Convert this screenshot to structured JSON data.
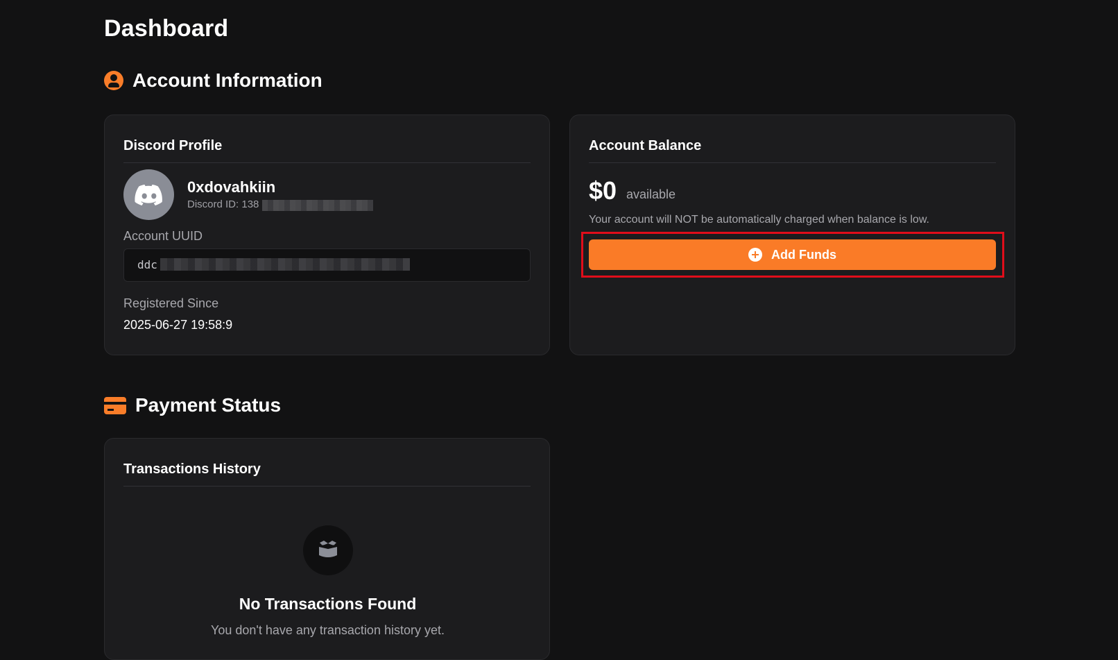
{
  "page": {
    "title": "Dashboard"
  },
  "account_section": {
    "title": "Account Information",
    "icon": "user-circle-icon"
  },
  "discord_profile": {
    "title": "Discord Profile",
    "avatar_icon": "discord-icon",
    "username": "0xdovahkiin",
    "discord_id_label": "Discord ID: 138",
    "uuid_label": "Account UUID",
    "uuid_value": "ddc",
    "registered_label": "Registered Since",
    "registered_value": "2025-06-27 19:58:9"
  },
  "account_balance": {
    "title": "Account Balance",
    "amount": "$0",
    "available_label": "available",
    "note": "Your account will NOT be automatically charged when balance is low.",
    "add_funds_label": "Add Funds",
    "add_funds_icon": "plus-circle-icon"
  },
  "payment_section": {
    "title": "Payment Status",
    "icon": "credit-card-icon"
  },
  "transactions": {
    "title": "Transactions History",
    "empty_icon": "box-icon",
    "empty_title": "No Transactions Found",
    "empty_subtitle": "You don't have any transaction history yet."
  },
  "colors": {
    "background": "#121213",
    "card": "#1c1c1e",
    "accent": "#fa7b27",
    "highlight": "#e00d1a"
  }
}
